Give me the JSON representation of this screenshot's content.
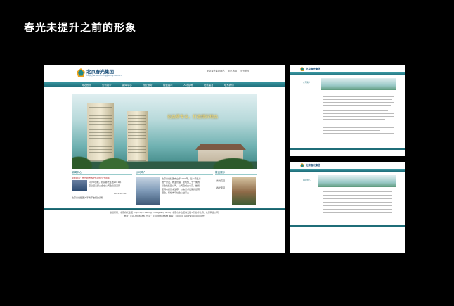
{
  "page": {
    "title": "春光未提升之前的形象"
  },
  "main_site": {
    "logo_text": "北京春光集团",
    "logo_url": "http://www.chungguang.com.cn",
    "header_links": [
      "北京春光集团网站",
      "加入收藏",
      "设为首页"
    ],
    "nav": [
      "网站首页",
      "公司简介",
      "新闻中心",
      "物业服务",
      "楼盘展示",
      "人才招聘",
      "在线留言",
      "联系我们"
    ],
    "hero_slogan": "创品质专业，打造精彩精品",
    "sections": [
      {
        "title": "新闻中心",
        "lines": [
          "最新报道：热烈祝贺春光集团成立十周年",
          "1月30日晚，北京春光集团2011年",
          "度总结表彰大会在公司会议室召开...",
          "2011-02-08",
          "北京春光集团关于春节放假的通知"
        ]
      },
      {
        "title": "公司简介",
        "lines": [
          "北京春光集团成立于1997年，是一家集房",
          "地产开发、物业管理、建筑施工于一体的",
          "综合性集团公司。公司自成立以来，始终",
          "坚持以质量求生存、以信誉求发展的经营",
          "理念，积极参与社会公益事业..."
        ]
      },
      {
        "title": "楼盘展示",
        "lines": [
          "春光花园",
          "春光家园"
        ]
      }
    ],
    "footer_lines": [
      "版权所有：北京春光集团 Copyright Beijing Chunguang Group  北京市丰台区春光路1号  技术支持：北京网络公司",
      "电话：010-88888888  传真：010-88888888  邮编：100000  京ICP备00000000号"
    ]
  },
  "small_site_1": {
    "logo_text": "北京春光集团",
    "side_title": "公司简介"
  },
  "small_site_2": {
    "logo_text": "北京春光集团",
    "side_title": "新闻中心"
  },
  "colors": {
    "accent": "#1d6c78",
    "nav": "#3c9aa4",
    "background": "#000000"
  }
}
